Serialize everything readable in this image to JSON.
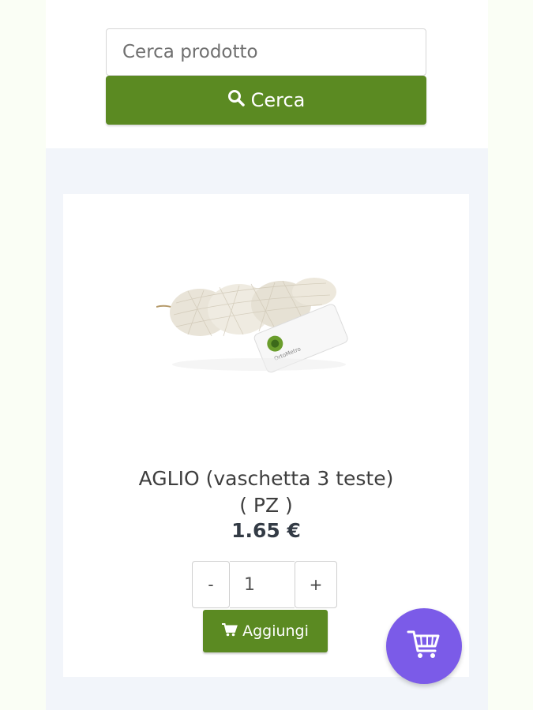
{
  "search": {
    "placeholder": "Cerca prodotto",
    "button_label": "Cerca",
    "button_icon": "search-icon"
  },
  "product": {
    "name": "AGLIO (vaschetta 3 teste)",
    "unit": "( PZ )",
    "price": "1.65 €",
    "tag_label": "OrtoMetro",
    "quantity": {
      "minus_label": "-",
      "value": "1",
      "plus_label": "+"
    },
    "add_button_label": "Aggiungi",
    "add_button_icon": "cart-icon"
  },
  "cart_fab": {
    "icon": "shopping-cart-icon"
  },
  "colors": {
    "primary_green": "#5b8a22",
    "fab_purple": "#7b5be8",
    "content_bg": "#f2f5fa",
    "page_bg": "#fafef5"
  }
}
